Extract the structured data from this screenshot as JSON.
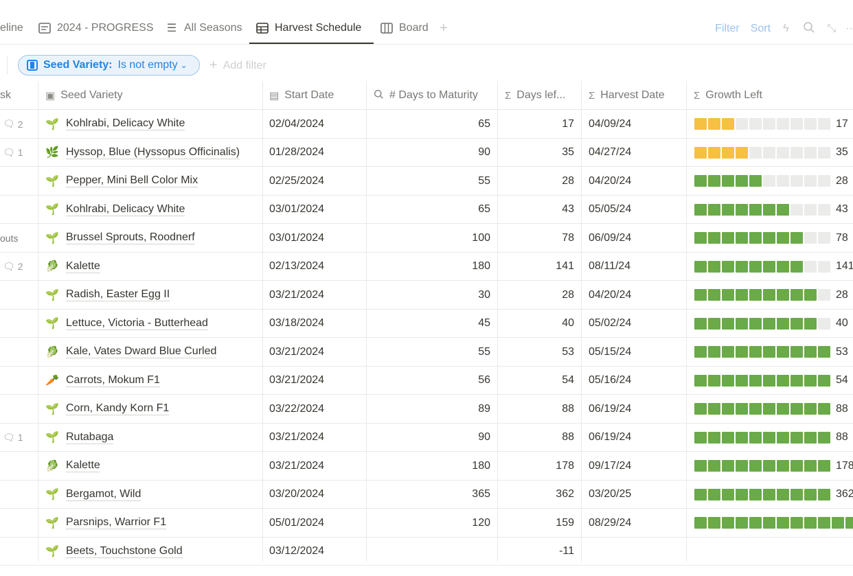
{
  "tabs": [
    {
      "label": "eline",
      "icon": ""
    },
    {
      "label": "2024 - PROGRESS",
      "icon": "page-icon"
    },
    {
      "label": "All Seasons",
      "icon": "list-icon"
    },
    {
      "label": "Harvest Schedule",
      "icon": "table-icon",
      "active": true
    },
    {
      "label": "Board",
      "icon": "board-icon"
    }
  ],
  "toolbar": {
    "filter": "Filter",
    "sort": "Sort"
  },
  "filter": {
    "property": "Seed Variety:",
    "condition": "Is not empty",
    "add_filter": "Add filter"
  },
  "columns": {
    "task": "sk",
    "seed": "Seed Variety",
    "start": "Start Date",
    "days": "# Days to Maturity",
    "left": "Days lef...",
    "harvest": "Harvest Date",
    "growth": "Growth Left"
  },
  "colors": {
    "yellow": "#f6c042",
    "green": "#6aaa48",
    "empty": "#ebebea",
    "accent": "#2383e2"
  },
  "rows": [
    {
      "task": "",
      "comments": "2",
      "icon": "🌱",
      "seed": "Kohlrabi, Delicacy White",
      "start": "02/04/2024",
      "days": "65",
      "left": "17",
      "harvest": "04/09/24",
      "growth_color": "yellow",
      "growth_filled": 3,
      "growth": "17"
    },
    {
      "task": "",
      "comments": "1",
      "icon": "🌿",
      "seed": "Hyssop, Blue (Hyssopus Officinalis)",
      "start": "01/28/2024",
      "days": "90",
      "left": "35",
      "harvest": "04/27/24",
      "growth_color": "yellow",
      "growth_filled": 4,
      "growth": "35"
    },
    {
      "task": "",
      "comments": "",
      "icon": "🌱",
      "seed": "Pepper, Mini Bell Color Mix",
      "start": "02/25/2024",
      "days": "55",
      "left": "28",
      "harvest": "04/20/24",
      "growth_color": "green",
      "growth_filled": 5,
      "growth": "28"
    },
    {
      "task": "",
      "comments": "",
      "icon": "🌱",
      "seed": "Kohlrabi, Delicacy White",
      "start": "03/01/2024",
      "days": "65",
      "left": "43",
      "harvest": "05/05/24",
      "growth_color": "green",
      "growth_filled": 7,
      "growth": "43"
    },
    {
      "task": "outs",
      "comments": "",
      "icon": "🌱",
      "seed": "Brussel Sprouts, Roodnerf",
      "start": "03/01/2024",
      "days": "100",
      "left": "78",
      "harvest": "06/09/24",
      "growth_color": "green",
      "growth_filled": 8,
      "growth": "78"
    },
    {
      "task": "",
      "comments": "2",
      "icon": "🥬",
      "seed": "Kalette",
      "start": "02/13/2024",
      "days": "180",
      "left": "141",
      "harvest": "08/11/24",
      "growth_color": "green",
      "growth_filled": 8,
      "growth": "141"
    },
    {
      "task": "",
      "comments": "",
      "icon": "🌱",
      "seed": "Radish, Easter Egg II",
      "start": "03/21/2024",
      "days": "30",
      "left": "28",
      "harvest": "04/20/24",
      "growth_color": "green",
      "growth_filled": 9,
      "growth": "28"
    },
    {
      "task": "",
      "comments": "",
      "icon": "🌱",
      "seed": "Lettuce, Victoria - Butterhead",
      "start": "03/18/2024",
      "days": "45",
      "left": "40",
      "harvest": "05/02/24",
      "growth_color": "green",
      "growth_filled": 9,
      "growth": "40"
    },
    {
      "task": "",
      "comments": "",
      "icon": "🥬",
      "seed": "Kale, Vates Dward Blue Curled",
      "start": "03/21/2024",
      "days": "55",
      "left": "53",
      "harvest": "05/15/24",
      "growth_color": "green",
      "growth_filled": 10,
      "growth": "53"
    },
    {
      "task": "",
      "comments": "",
      "icon": "🥕",
      "seed": "Carrots, Mokum F1",
      "start": "03/21/2024",
      "days": "56",
      "left": "54",
      "harvest": "05/16/24",
      "growth_color": "green",
      "growth_filled": 10,
      "growth": "54"
    },
    {
      "task": "",
      "comments": "",
      "icon": "🌱",
      "seed": "Corn, Kandy Korn F1",
      "start": "03/22/2024",
      "days": "89",
      "left": "88",
      "harvest": "06/19/24",
      "growth_color": "green",
      "growth_filled": 10,
      "growth": "88"
    },
    {
      "task": "",
      "comments": "1",
      "icon": "🌱",
      "seed": "Rutabaga",
      "start": "03/21/2024",
      "days": "90",
      "left": "88",
      "harvest": "06/19/24",
      "growth_color": "green",
      "growth_filled": 10,
      "growth": "88"
    },
    {
      "task": "",
      "comments": "",
      "icon": "🥬",
      "seed": "Kalette",
      "start": "03/21/2024",
      "days": "180",
      "left": "178",
      "harvest": "09/17/24",
      "growth_color": "green",
      "growth_filled": 10,
      "growth": "178"
    },
    {
      "task": "",
      "comments": "",
      "icon": "🌱",
      "seed": "Bergamot, Wild",
      "start": "03/20/2024",
      "days": "365",
      "left": "362",
      "harvest": "03/20/25",
      "growth_color": "green",
      "growth_filled": 10,
      "growth": "362"
    },
    {
      "task": "",
      "comments": "",
      "icon": "🌱",
      "seed": "Parsnips, Warrior F1",
      "start": "05/01/2024",
      "days": "120",
      "left": "159",
      "harvest": "08/29/24",
      "growth_color": "green",
      "growth_filled": 12,
      "growth": ""
    },
    {
      "task": "",
      "comments": "",
      "icon": "🌱",
      "seed": "Beets, Touchstone Gold",
      "start": "03/12/2024",
      "days": "",
      "left": "-11",
      "harvest": "",
      "growth_color": "none",
      "growth_filled": 0,
      "growth": ""
    }
  ]
}
